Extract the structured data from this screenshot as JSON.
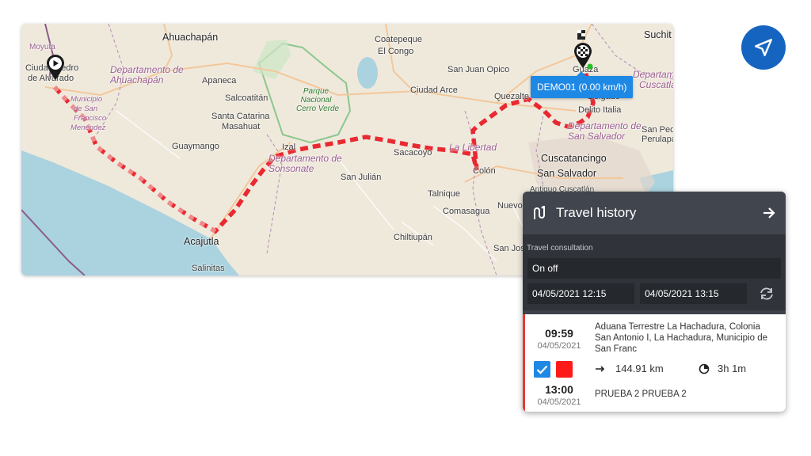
{
  "map": {
    "labels": {
      "moyuta": "Moyuta",
      "ciudad_pedro": "Ciudad Pedro",
      "de_alvarado": "de Alvarado",
      "ahuachapan": "Ahuachapán",
      "dep_ahuachapan": "Departamento de Ahuachapán",
      "apaneca": "Apaneca",
      "salcoatitan": "Salcoatitán",
      "santa_catarina": "Santa Catarina",
      "masahuat": "Masahuat",
      "guaymango": "Guaymango",
      "municipio": "Municipio",
      "de_san": "de San",
      "francisco": "Francisco",
      "menendez": "Menéndez",
      "acajutla": "Acajutla",
      "salinitas": "Salinitas",
      "coatepeque": "Coatepeque",
      "el_congo": "El Congo",
      "parque": "Parque",
      "nacional": "Nacional",
      "cerro_verde": "Cerro Verde",
      "izalco": "Izal",
      "dep_sonsonate": "Departamento de Sonsonate",
      "san_julian": "San Julián",
      "sacacoyo": "Sacacoyo",
      "la_libertad": "La Libertad",
      "colon": "Colón",
      "talnique": "Talnique",
      "comasagua": "Comasagua",
      "chiltiupan": "Chiltiupán",
      "san_juan_opico": "San Juan Opico",
      "ciudad_arce": "Ciudad Arce",
      "quezaltepeque": "Quezalte",
      "antiguo_cuscatlan": "Antiguo Cuscatlán",
      "nuevo": "Nuevo",
      "san_jose": "San Jos",
      "suchitoto": "Suchit",
      "guazapa": "Guaza",
      "departamento": "Departamento",
      "cuscatlan": "Cuscatlán",
      "delgado": "Delgado",
      "merito_italia": "Delito Italia",
      "dep_san_salvador": "Departamento de San Salvador",
      "cuscatancingo": "Cuscatancingo",
      "san_salvador": "San Salvador",
      "san_pedro": "San Ped",
      "perulapa": "Perulapa"
    },
    "device_label": "DEMO01 (0.00 km/h)",
    "route_color": "#e8141e",
    "start_icon": "play-marker-icon",
    "end_icon": "checkered-flag-marker-icon"
  },
  "nav_button": {
    "icon": "navigation-arrow-icon",
    "color": "#1565c0"
  },
  "panel": {
    "icon": "route-icon",
    "title": "Travel history",
    "close_icon": "arrow-right-icon",
    "subtitle": "Travel consultation",
    "mode": "On off",
    "date_from": "04/05/2021 12:15",
    "date_to": "04/05/2021 13:15",
    "refresh_icon": "refresh-icon",
    "trip": {
      "start_time": "09:59",
      "start_date": "04/05/2021",
      "end_time": "13:00",
      "end_date": "04/05/2021",
      "address": "Aduana Terrestre La Hachadura, Colonia San Antonio I, La Hachadura, Municipio de San Franc",
      "distance": "144.91 km",
      "duration": "3h 1m",
      "driver": "PRUEBA 2 PRUEBA 2",
      "checked": true,
      "color": "#ff1a1a"
    }
  }
}
